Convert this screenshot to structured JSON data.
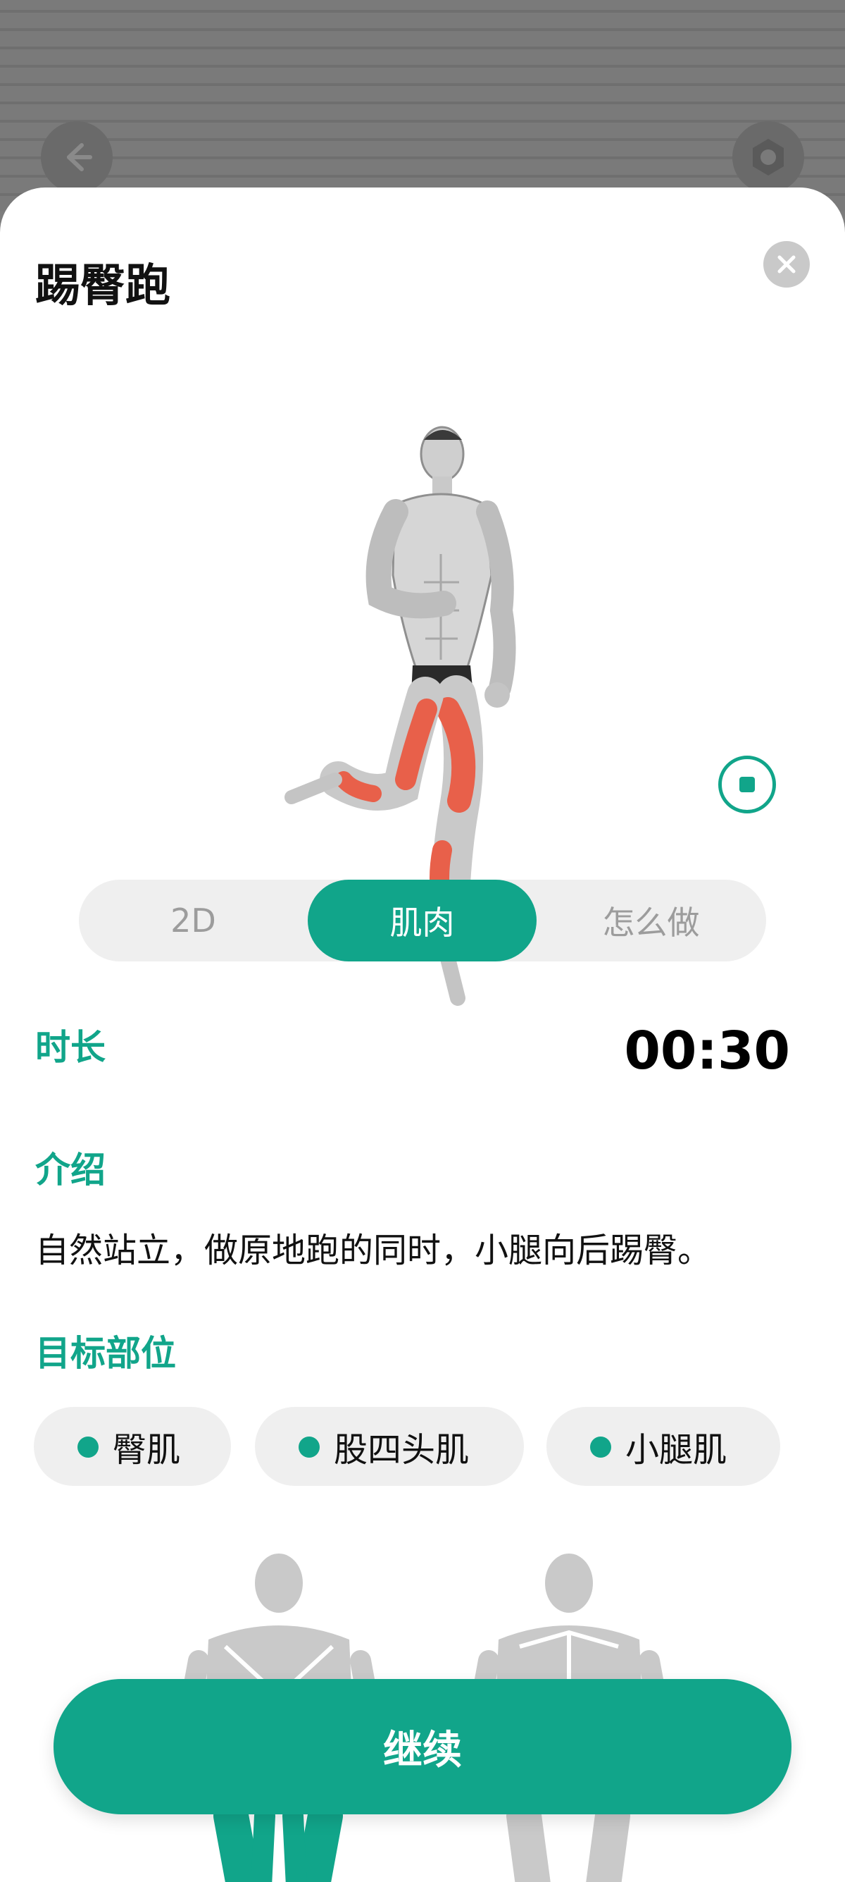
{
  "background": {
    "back_icon": "arrow-left-icon",
    "settings_icon": "gear-icon"
  },
  "sheet": {
    "title": "踢臀跑",
    "close_icon": "close-icon",
    "stop_icon": "stop-icon"
  },
  "tabs": [
    {
      "label": "2D",
      "active": false
    },
    {
      "label": "肌肉",
      "active": true
    },
    {
      "label": "怎么做",
      "active": false
    }
  ],
  "duration": {
    "label": "时长",
    "value": "00:30"
  },
  "intro": {
    "label": "介绍",
    "text": "自然站立，做原地跑的同时，小腿向后踢臀。"
  },
  "target": {
    "label": "目标部位",
    "chips": [
      "臀肌",
      "股四头肌",
      "小腿肌"
    ]
  },
  "continue_label": "继续",
  "colors": {
    "accent": "#11a58a",
    "muscle_highlight": "#e8604a"
  }
}
